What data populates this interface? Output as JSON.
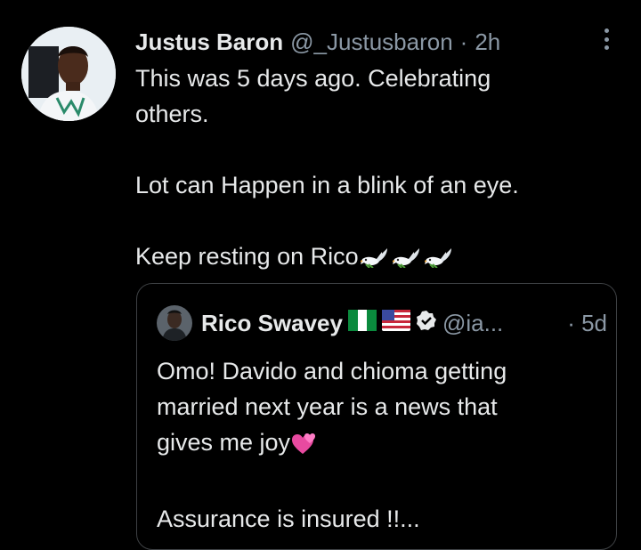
{
  "tweet": {
    "author_name": "Justus Baron",
    "author_handle": "@_Justusbaron",
    "separator": "·",
    "time": "2h",
    "text_line1": "This was 5 days ago. Celebrating",
    "text_line2": "others.",
    "text_line3": "Lot can Happen in a blink of an eye.",
    "text_line4": "Keep resting on Rico",
    "emoji_icons": [
      "dove-icon",
      "dove-icon",
      "dove-icon"
    ]
  },
  "quoted_tweet": {
    "author_name": "Rico Swavey",
    "flags": [
      "nigeria-flag-icon",
      "us-flag-icon"
    ],
    "verified_icon": "verified-badge-icon",
    "author_handle": "@ia...",
    "time": "· 5d",
    "text_line1": "Omo! Davido and chioma getting",
    "text_line2": "married next year is a news that",
    "text_line3": "gives me joy",
    "text_line3_emoji": "two-hearts-icon",
    "text_line4": "Assurance is insured !!..."
  },
  "colors": {
    "background": "#000000",
    "primary_text": "#e7e9ea",
    "secondary_text": "#8b98a5",
    "border": "#3e4144"
  }
}
